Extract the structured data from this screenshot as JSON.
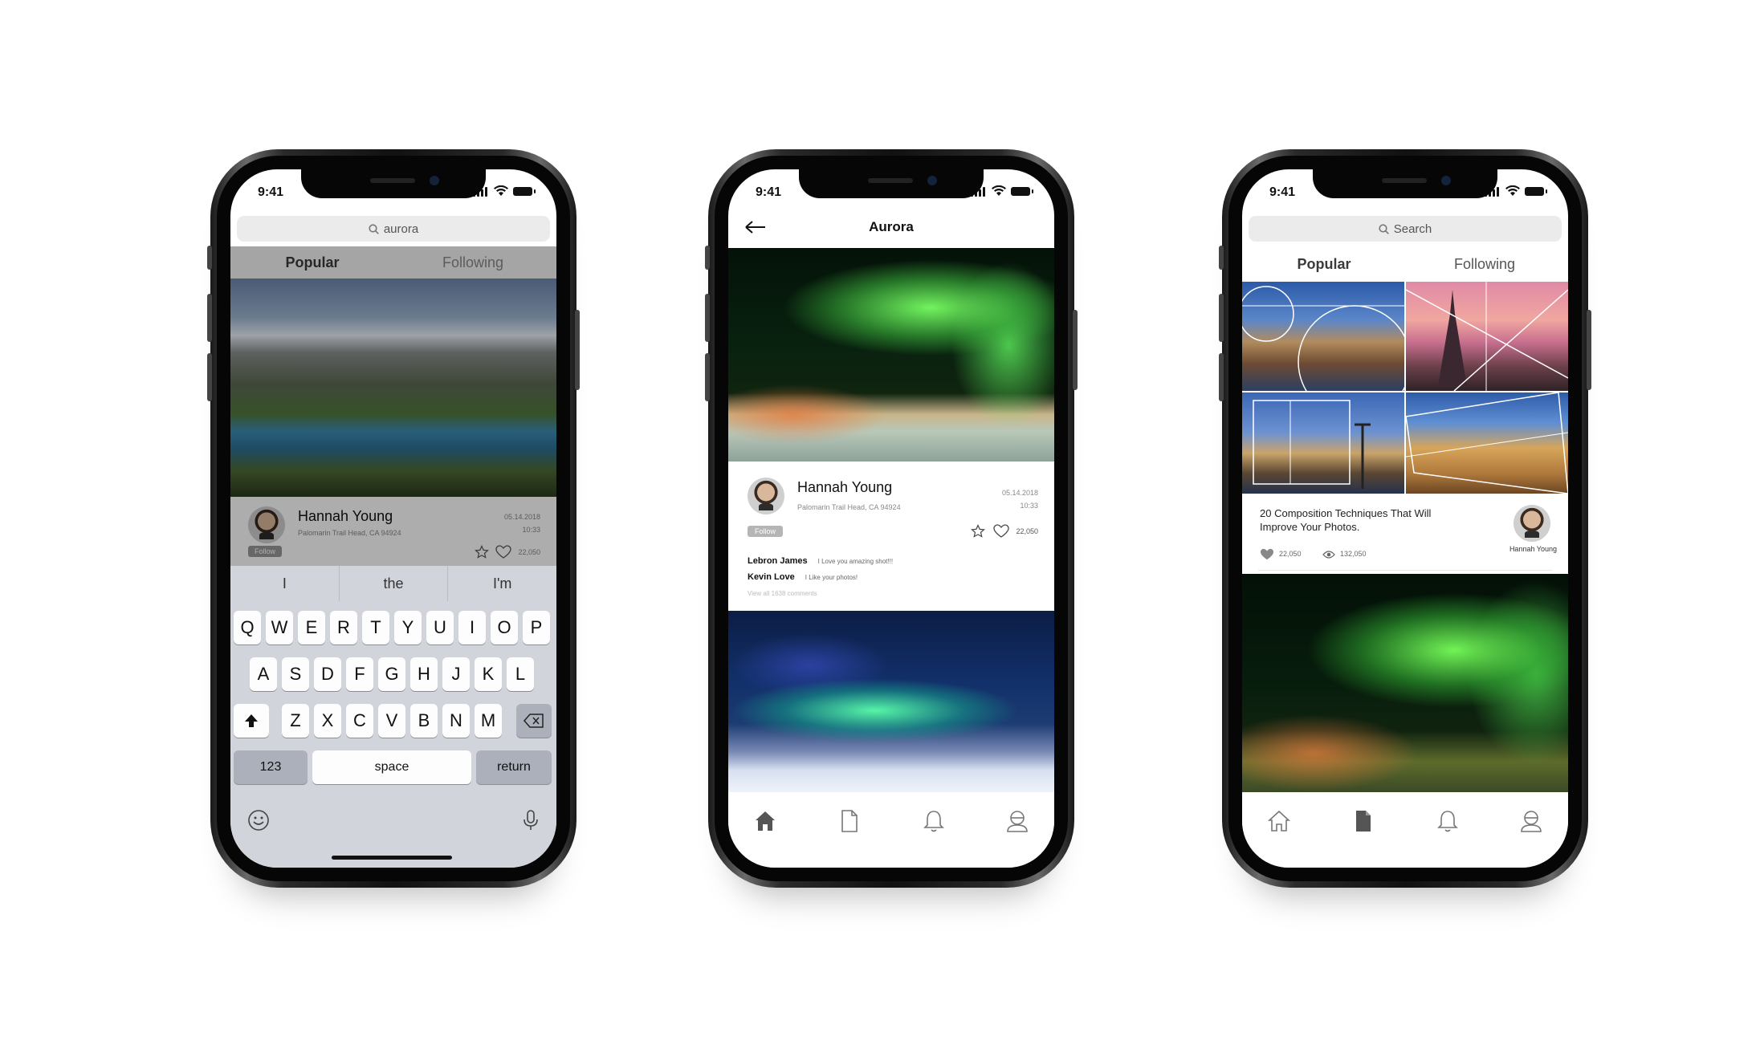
{
  "status": {
    "time": "9:41"
  },
  "phone1": {
    "search": "aurora",
    "tabs": [
      "Popular",
      "Following"
    ],
    "post": {
      "name": "Hannah Young",
      "location": "Palomarin Trail Head, CA 94924",
      "date": "05.14.2018",
      "time": "10:33",
      "follow": "Follow",
      "likes": "22,050"
    },
    "suggestions": [
      "I",
      "the",
      "I'm"
    ],
    "keys_row1": [
      "Q",
      "W",
      "E",
      "R",
      "T",
      "Y",
      "U",
      "I",
      "O",
      "P"
    ],
    "keys_row2": [
      "A",
      "S",
      "D",
      "F",
      "G",
      "H",
      "J",
      "K",
      "L"
    ],
    "keys_row3": [
      "Z",
      "X",
      "C",
      "V",
      "B",
      "N",
      "M"
    ],
    "key_123": "123",
    "key_space": "space",
    "key_return": "return"
  },
  "phone2": {
    "title": "Aurora",
    "post": {
      "name": "Hannah Young",
      "location": "Palomarin Trail Head, CA 94924",
      "date": "05.14.2018",
      "time": "10:33",
      "follow": "Follow",
      "likes": "22,050"
    },
    "comments": [
      {
        "user": "Lebron James",
        "text": "I Love you amazing shot!!!"
      },
      {
        "user": "Kevin Love",
        "text": "I Like your photos!"
      }
    ],
    "view_all": "View all 1638 comments"
  },
  "phone3": {
    "search": "Search",
    "tabs": [
      "Popular",
      "Following"
    ],
    "article": {
      "title_line1": "20 Composition Techniques That Will",
      "title_line2": "Improve Your Photos.",
      "author": "Hannah Young",
      "likes": "22,050",
      "views": "132,050"
    }
  },
  "colors": {
    "accent_tab": "#3a3a3a",
    "inactive_tab": "#888888",
    "keyboard_bg": "#d1d4da"
  }
}
